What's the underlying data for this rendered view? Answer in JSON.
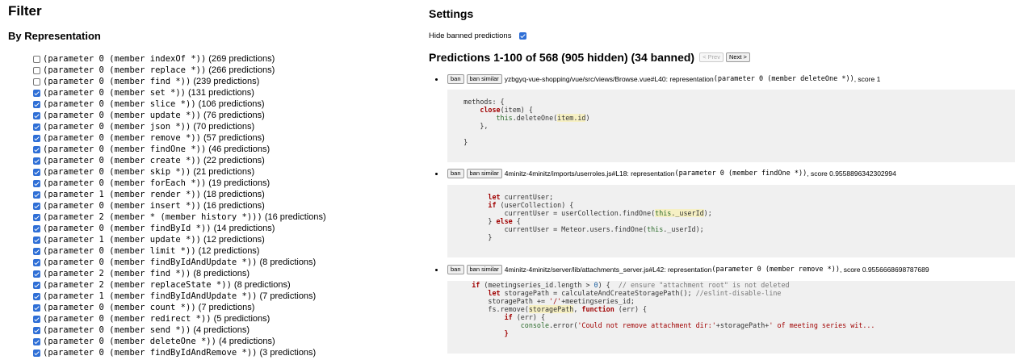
{
  "filter": {
    "title": "Filter",
    "subtitle": "By Representation",
    "items": [
      {
        "text": "(parameter 0 (member indexOf *))",
        "count": "(269 predictions)",
        "checked": false
      },
      {
        "text": "(parameter 0 (member replace *))",
        "count": "(266 predictions)",
        "checked": false
      },
      {
        "text": "(parameter 0 (member find *))",
        "count": "(239 predictions)",
        "checked": false
      },
      {
        "text": "(parameter 0 (member set *))",
        "count": "(131 predictions)",
        "checked": true
      },
      {
        "text": "(parameter 0 (member slice *))",
        "count": "(106 predictions)",
        "checked": true
      },
      {
        "text": "(parameter 0 (member update *))",
        "count": "(76 predictions)",
        "checked": true
      },
      {
        "text": "(parameter 0 (member json *))",
        "count": "(70 predictions)",
        "checked": true
      },
      {
        "text": "(parameter 0 (member remove *))",
        "count": "(57 predictions)",
        "checked": true
      },
      {
        "text": "(parameter 0 (member findOne *))",
        "count": "(46 predictions)",
        "checked": true
      },
      {
        "text": "(parameter 0 (member create *))",
        "count": "(22 predictions)",
        "checked": true
      },
      {
        "text": "(parameter 0 (member skip *))",
        "count": "(21 predictions)",
        "checked": true
      },
      {
        "text": "(parameter 0 (member forEach *))",
        "count": "(19 predictions)",
        "checked": true
      },
      {
        "text": "(parameter 1 (member render *))",
        "count": "(18 predictions)",
        "checked": true
      },
      {
        "text": "(parameter 0 (member insert *))",
        "count": "(16 predictions)",
        "checked": true
      },
      {
        "text": "(parameter 2 (member * (member history *)))",
        "count": "(16 predictions)",
        "checked": true
      },
      {
        "text": "(parameter 0 (member findById *))",
        "count": "(14 predictions)",
        "checked": true
      },
      {
        "text": "(parameter 1 (member update *))",
        "count": "(12 predictions)",
        "checked": true
      },
      {
        "text": "(parameter 0 (member limit *))",
        "count": "(12 predictions)",
        "checked": true
      },
      {
        "text": "(parameter 0 (member findByIdAndUpdate *))",
        "count": "(8 predictions)",
        "checked": true
      },
      {
        "text": "(parameter 2 (member find *))",
        "count": "(8 predictions)",
        "checked": true
      },
      {
        "text": "(parameter 2 (member replaceState *))",
        "count": "(8 predictions)",
        "checked": true
      },
      {
        "text": "(parameter 1 (member findByIdAndUpdate *))",
        "count": "(7 predictions)",
        "checked": true
      },
      {
        "text": "(parameter 0 (member count *))",
        "count": "(7 predictions)",
        "checked": true
      },
      {
        "text": "(parameter 0 (member redirect *))",
        "count": "(5 predictions)",
        "checked": true
      },
      {
        "text": "(parameter 0 (member send *))",
        "count": "(4 predictions)",
        "checked": true
      },
      {
        "text": "(parameter 0 (member deleteOne *))",
        "count": "(4 predictions)",
        "checked": true
      },
      {
        "text": "(parameter 0 (member findByIdAndRemove *))",
        "count": "(3 predictions)",
        "checked": true
      }
    ]
  },
  "settings": {
    "title": "Settings",
    "hide_banned_label": "Hide banned predictions",
    "hide_banned_checked": true
  },
  "predictions": {
    "title": "Predictions 1-100 of 568 (905 hidden) (34 banned)",
    "prev_label": "< Prev",
    "next_label": "Next >",
    "ban_label": "ban",
    "ban_similar_label": "ban similar",
    "results": [
      {
        "location": "yzbgyq-vue-shopping/vue/src/views/Browse.vue#L40: representation ",
        "representation": "(parameter 0 (member deleteOne *))",
        "score": ", score 1"
      },
      {
        "location": "4minitz-4minitz/imports/userroles.js#L18: representation ",
        "representation": "(parameter 0 (member findOne *))",
        "score": ", score 0.9558896342302994"
      },
      {
        "location": "4minitz-4minitz/server/lib/attachments_server.js#L42: representation ",
        "representation": "(parameter 0 (member remove *))",
        "score": ", score 0.9556668698787689"
      }
    ]
  },
  "colors": {
    "checkbox_checked": "#2f6fd6",
    "code_background": "#f0f0f0",
    "keyword": "#a00000",
    "highlight": "#f6f0c4"
  }
}
